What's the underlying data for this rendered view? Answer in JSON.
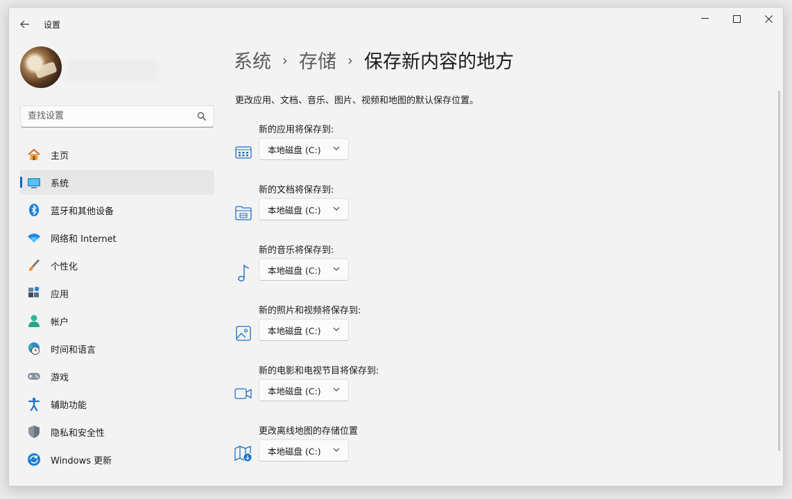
{
  "window": {
    "title": "设置"
  },
  "search": {
    "placeholder": "查找设置"
  },
  "sidebar": {
    "items": [
      {
        "label": "主页",
        "icon": "home-icon"
      },
      {
        "label": "系统",
        "icon": "system-icon",
        "active": true
      },
      {
        "label": "蓝牙和其他设备",
        "icon": "bluetooth-icon"
      },
      {
        "label": "网络和 Internet",
        "icon": "wifi-icon"
      },
      {
        "label": "个性化",
        "icon": "brush-icon"
      },
      {
        "label": "应用",
        "icon": "apps-icon"
      },
      {
        "label": "帐户",
        "icon": "account-icon"
      },
      {
        "label": "时间和语言",
        "icon": "time-language-icon"
      },
      {
        "label": "游戏",
        "icon": "gaming-icon"
      },
      {
        "label": "辅助功能",
        "icon": "accessibility-icon"
      },
      {
        "label": "隐私和安全性",
        "icon": "shield-icon"
      },
      {
        "label": "Windows 更新",
        "icon": "update-icon"
      }
    ]
  },
  "breadcrumb": {
    "level1": "系统",
    "level2": "存储",
    "current": "保存新内容的地方",
    "separator": "›"
  },
  "description": "更改应用、文档、音乐、图片、视频和地图的默认保存位置。",
  "settings": [
    {
      "label": "新的应用将保存到:",
      "value": "本地磁盘 (C:)",
      "icon": "apps-storage-icon"
    },
    {
      "label": "新的文档将保存到:",
      "value": "本地磁盘 (C:)",
      "icon": "folder-icon"
    },
    {
      "label": "新的音乐将保存到:",
      "value": "本地磁盘 (C:)",
      "icon": "music-note-icon"
    },
    {
      "label": "新的照片和视频将保存到:",
      "value": "本地磁盘 (C:)",
      "icon": "picture-icon"
    },
    {
      "label": "新的电影和电视节目将保存到:",
      "value": "本地磁盘 (C:)",
      "icon": "video-camera-icon"
    },
    {
      "label": "更改离线地图的存储位置",
      "value": "本地磁盘 (C:)",
      "icon": "map-download-icon"
    }
  ],
  "colors": {
    "accent": "#0067c0",
    "background": "#f3f3f3"
  }
}
